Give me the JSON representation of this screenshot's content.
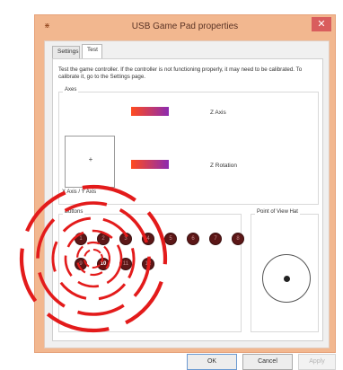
{
  "window": {
    "title": "USB Game Pad  properties",
    "app_icon": "gamepad-icon",
    "close_glyph": "✕",
    "accent_color": "#f2b78f",
    "close_color": "#d95d5d"
  },
  "tabs": [
    {
      "label": "Settings",
      "selected": false
    },
    {
      "label": "Test",
      "selected": true
    }
  ],
  "description": "Test the game controller.  If the controller is not functioning properly, it may need to be calibrated.  To calibrate it, go to the Settings page.",
  "axes": {
    "group_label": "Axes",
    "xy_label": "X Axis / Y Axis",
    "xy_marker": "+",
    "z_axis_label": "Z Axis",
    "z_rotation_label": "Z Rotation"
  },
  "buttons": {
    "group_label": "Buttons",
    "items": [
      {
        "label": "1"
      },
      {
        "label": "2"
      },
      {
        "label": "3"
      },
      {
        "label": "4"
      },
      {
        "label": "5"
      },
      {
        "label": "6"
      },
      {
        "label": "7"
      },
      {
        "label": "8"
      },
      {
        "label": "9"
      },
      {
        "label": "10"
      },
      {
        "label": "11"
      },
      {
        "label": "12"
      }
    ],
    "active_label": "10",
    "indicator_color": "#e31b1b"
  },
  "pov": {
    "group_label": "Point of View Hat"
  },
  "footer": {
    "ok_label": "OK",
    "cancel_label": "Cancel",
    "apply_label": "Apply",
    "apply_enabled": false
  }
}
